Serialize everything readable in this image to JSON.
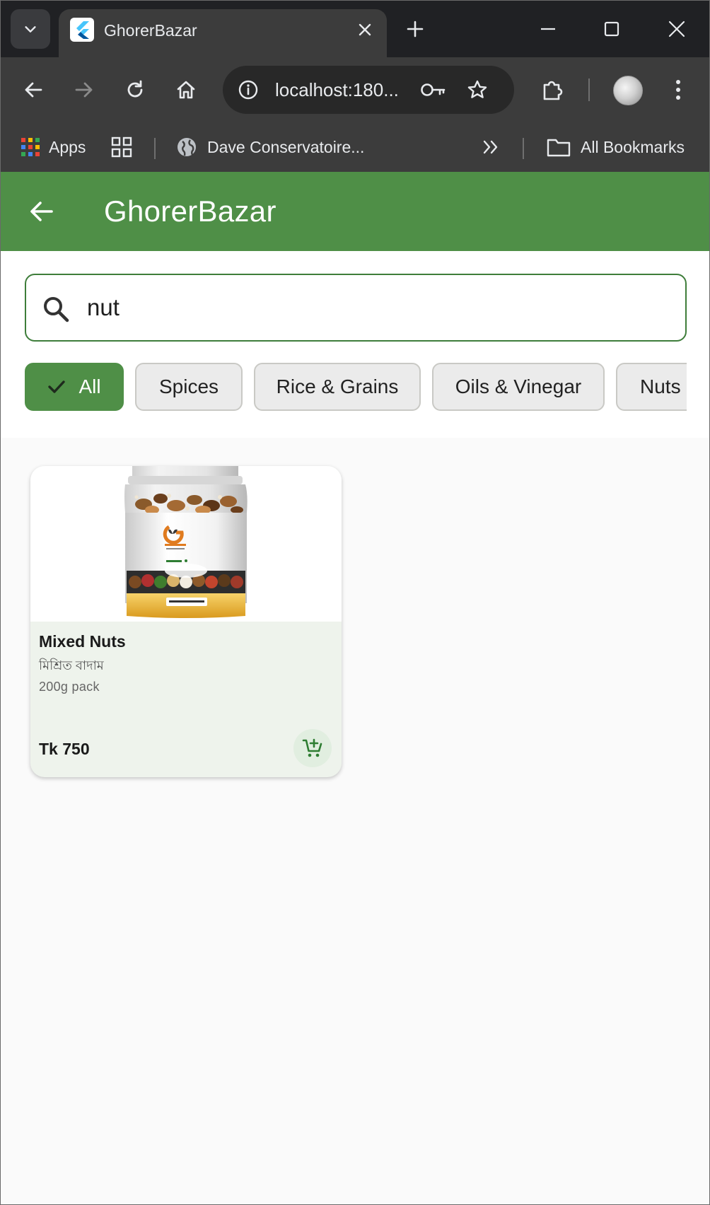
{
  "browser": {
    "tab_title": "GhorerBazar",
    "url": "localhost:180...",
    "bookmarks": {
      "apps_label": "Apps",
      "folder_label": "Dave Conservatoire...",
      "all_label": "All Bookmarks"
    }
  },
  "app": {
    "title": "GhorerBazar",
    "accent_color": "#4f8f47",
    "search": {
      "value": "nut",
      "placeholder": ""
    },
    "categories": [
      {
        "label": "All",
        "selected": true
      },
      {
        "label": "Spices",
        "selected": false
      },
      {
        "label": "Rice & Grains",
        "selected": false
      },
      {
        "label": "Oils & Vinegar",
        "selected": false
      },
      {
        "label": "Nuts",
        "selected": false
      }
    ],
    "products": [
      {
        "name": "Mixed Nuts",
        "name_bn": "মিশ্রিত বাদাম",
        "unit": "200g pack",
        "price": "Tk 750",
        "image_icon": "nut-jar-image",
        "action_icon": "add-shopping-cart-icon"
      }
    ]
  }
}
